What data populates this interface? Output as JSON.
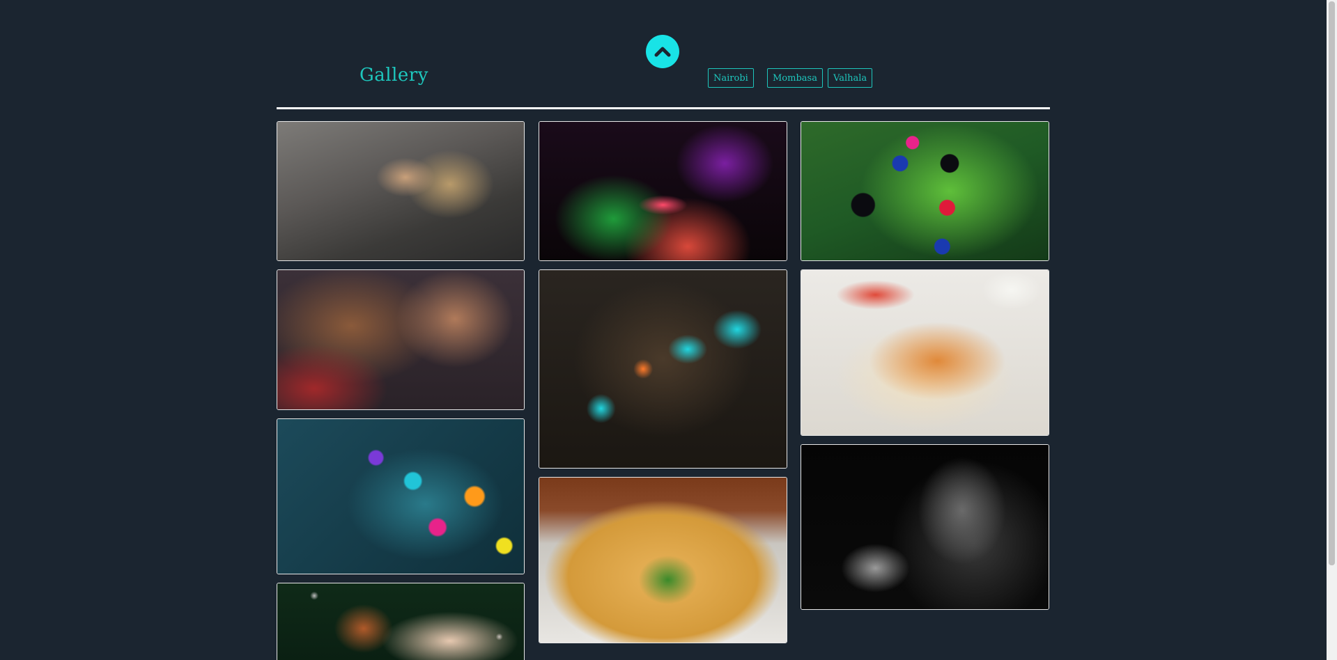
{
  "header": {
    "title": "Gallery",
    "scroll_top_icon": "chevron-up-icon",
    "nav": [
      "Nairobi",
      "Mombasa",
      "Valhala"
    ]
  },
  "gallery": {
    "images": [
      {
        "name": "viking-warrior-image"
      },
      {
        "name": "neon-face-image"
      },
      {
        "name": "colorful-buttons-image"
      },
      {
        "name": "armored-viking-image"
      },
      {
        "name": "cyber-abstract-image"
      },
      {
        "name": "chicken-biryani-image"
      },
      {
        "name": "colorful-stars-image"
      },
      {
        "name": "pizza-image"
      },
      {
        "name": "monochrome-portrait-image"
      },
      {
        "name": "robot-character-image"
      }
    ]
  },
  "colors": {
    "background": "#1b2530",
    "accent": "#1ec7bd",
    "scroll_button": "#19e3e6"
  }
}
